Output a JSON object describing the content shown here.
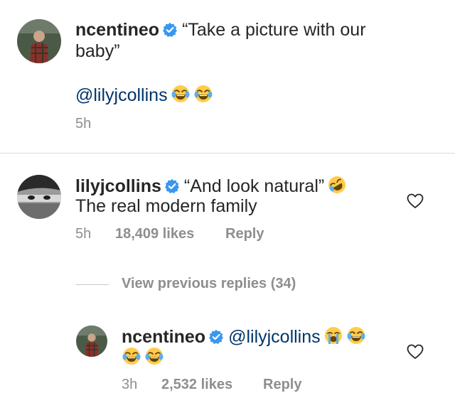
{
  "comment1": {
    "username": "ncentineo",
    "text_line1": "“Take a picture with our",
    "text_line2": "baby”",
    "mention": "@lilyjcollins",
    "time": "5h"
  },
  "comment2": {
    "username": "lilyjcollins",
    "text_line1": "“And look natural”",
    "text_line2": "The real modern family",
    "time": "5h",
    "likes": "18,409 likes",
    "reply": "Reply"
  },
  "view_replies": "View previous replies (34)",
  "reply1": {
    "username": "ncentineo",
    "mention": "@lilyjcollins",
    "time": "3h",
    "likes": "2,532 likes",
    "reply": "Reply"
  },
  "colors": {
    "verified": "#3897f0",
    "mention": "#003569",
    "meta": "#8e8e8e",
    "divider": "#dbdbdb"
  },
  "icons": [
    "verified-badge-icon",
    "laughing-crying-emoji",
    "rolling-laughing-emoji",
    "loudly-crying-emoji",
    "heart-outline-icon"
  ]
}
